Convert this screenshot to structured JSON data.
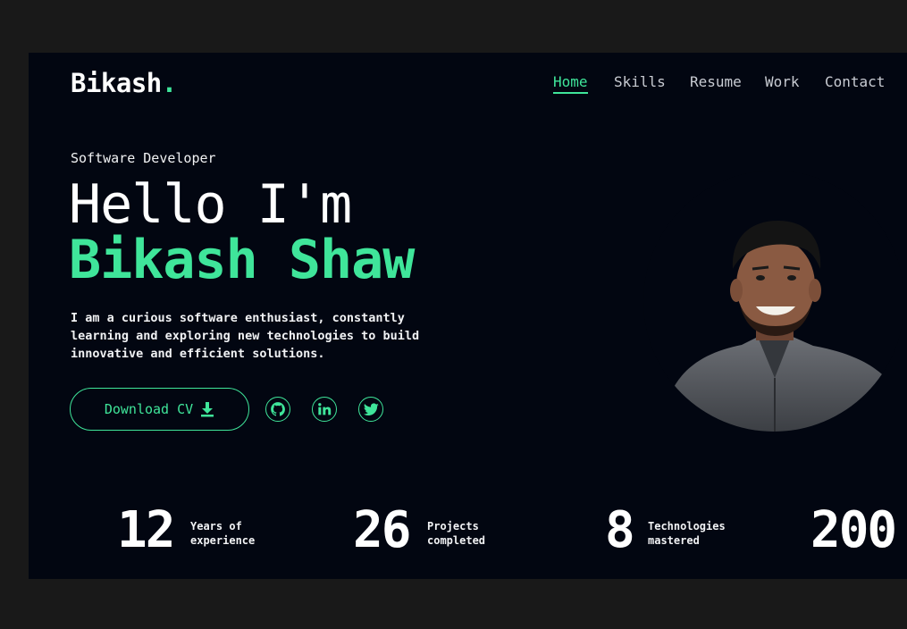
{
  "header": {
    "logo": "Bikash",
    "logo_dot": ".",
    "nav": [
      {
        "label": "Home",
        "active": true
      },
      {
        "label": "Skills",
        "active": false
      },
      {
        "label": "Resume",
        "active": false
      },
      {
        "label": "Work",
        "active": false
      },
      {
        "label": "Contact",
        "active": false
      }
    ]
  },
  "hero": {
    "role": "Software Developer",
    "greeting": "Hello I'm",
    "name": "Bikash Shaw",
    "bio": "I am a curious software enthusiast, constantly learning and exploring new technologies to build innovative and efficient solutions.",
    "cv_button": "Download CV",
    "socials": [
      "github-icon",
      "linkedin-icon",
      "twitter-icon"
    ]
  },
  "stats": [
    {
      "value": "12",
      "label": "Years of\nexperience"
    },
    {
      "value": "26",
      "label": "Projects\ncompleted"
    },
    {
      "value": "8",
      "label": "Technologies\nmastered"
    },
    {
      "value": "200",
      "label": ""
    }
  ],
  "colors": {
    "accent": "#3fe59a",
    "background": "#020611",
    "outer": "#191919"
  }
}
